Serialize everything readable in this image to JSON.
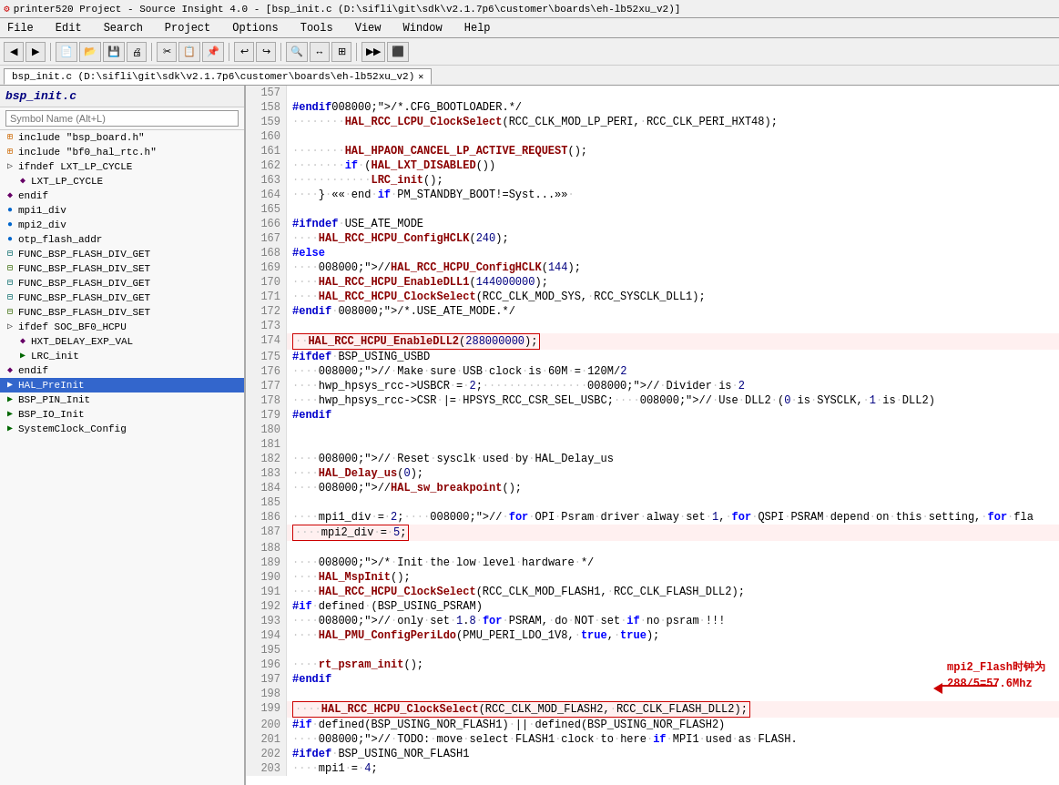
{
  "titlebar": {
    "logo": "⚙",
    "title": "printer520 Project - Source Insight 4.0 - [bsp_init.c (D:\\sifli\\git\\sdk\\v2.1.7p6\\customer\\boards\\eh-lb52xu_v2)]"
  },
  "menubar": {
    "items": [
      "File",
      "Edit",
      "Search",
      "Project",
      "Options",
      "Tools",
      "View",
      "Window",
      "Help"
    ]
  },
  "tab": {
    "label": "bsp_init.c (D:\\sifli\\git\\sdk\\v2.1.7p6\\customer\\boards\\eh-lb52xu_v2)",
    "close": "✕"
  },
  "leftpanel": {
    "title": "bsp_init.c",
    "search_placeholder": "Symbol Name (Alt+L)"
  },
  "tree": {
    "items": [
      {
        "indent": 0,
        "icon": "include",
        "label": "include \"bsp_board.h\""
      },
      {
        "indent": 0,
        "icon": "include",
        "label": "include \"bf0_hal_rtc.h\""
      },
      {
        "indent": 0,
        "icon": "expand",
        "label": "ifndef LXT_LP_CYCLE"
      },
      {
        "indent": 1,
        "icon": "define",
        "label": "LXT_LP_CYCLE"
      },
      {
        "indent": 0,
        "icon": "define",
        "label": "endif"
      },
      {
        "indent": 0,
        "icon": "var",
        "label": "mpi1_div"
      },
      {
        "indent": 0,
        "icon": "var",
        "label": "mpi2_div"
      },
      {
        "indent": 0,
        "icon": "var",
        "label": "otp_flash_addr"
      },
      {
        "indent": 0,
        "icon": "func_g",
        "label": "FUNC_BSP_FLASH_DIV_GET"
      },
      {
        "indent": 0,
        "icon": "func_s",
        "label": "FUNC_BSP_FLASH_DIV_SET"
      },
      {
        "indent": 0,
        "icon": "func_g",
        "label": "FUNC_BSP_FLASH_DIV_GET"
      },
      {
        "indent": 0,
        "icon": "func_g",
        "label": "FUNC_BSP_FLASH_DIV_GET"
      },
      {
        "indent": 0,
        "icon": "func_s",
        "label": "FUNC_BSP_FLASH_DIV_SET"
      },
      {
        "indent": 0,
        "icon": "expand",
        "label": "ifdef SOC_BF0_HCPU"
      },
      {
        "indent": 1,
        "icon": "define",
        "label": "HXT_DELAY_EXP_VAL"
      },
      {
        "indent": 1,
        "icon": "func",
        "label": "LRC_init"
      },
      {
        "indent": 0,
        "icon": "define",
        "label": "endif"
      },
      {
        "indent": 0,
        "icon": "func_sel",
        "label": "HAL_PreInit",
        "selected": true
      },
      {
        "indent": 0,
        "icon": "func",
        "label": "BSP_PIN_Init"
      },
      {
        "indent": 0,
        "icon": "func",
        "label": "BSP_IO_Init"
      },
      {
        "indent": 0,
        "icon": "func",
        "label": "SystemClock_Config"
      }
    ]
  },
  "code": {
    "lines": [
      {
        "num": 157,
        "content": ""
      },
      {
        "num": 158,
        "content": "#endif/*.CFG_BOOTLOADER.*/"
      },
      {
        "num": 159,
        "content": "········HAL_RCC_LCPU_ClockSelect(RCC_CLK_MOD_LP_PERI,·RCC_CLK_PERI_HXT48);"
      },
      {
        "num": 160,
        "content": ""
      },
      {
        "num": 161,
        "content": "········HAL_HPAON_CANCEL_LP_ACTIVE_REQUEST();"
      },
      {
        "num": 162,
        "content": "········if·(HAL_LXT_DISABLED())"
      },
      {
        "num": 163,
        "content": "············LRC_init();"
      },
      {
        "num": 164,
        "content": "····}·««·end·if·PM_STANDBY_BOOT!=Syst...»»·"
      },
      {
        "num": 165,
        "content": ""
      },
      {
        "num": 166,
        "content": "#ifndef·USE_ATE_MODE"
      },
      {
        "num": 167,
        "content": "····HAL_RCC_HCPU_ConfigHCLK(240);"
      },
      {
        "num": 168,
        "content": "#else"
      },
      {
        "num": 169,
        "content": "····//HAL_RCC_HCPU_ConfigHCLK(144);"
      },
      {
        "num": 170,
        "content": "····HAL_RCC_HCPU_EnableDLL1(144000000);"
      },
      {
        "num": 171,
        "content": "····HAL_RCC_HCPU_ClockSelect(RCC_CLK_MOD_SYS,·RCC_SYSCLK_DLL1);"
      },
      {
        "num": 172,
        "content": "#endif·/*.USE_ATE_MODE.*/"
      },
      {
        "num": 173,
        "content": ""
      },
      {
        "num": 174,
        "content": "··HAL_RCC_HCPU_EnableDLL2(288000000);",
        "highlight": true
      },
      {
        "num": 175,
        "content": "#ifdef·BSP_USING_USBD"
      },
      {
        "num": 176,
        "content": "····//·Make·sure·USB·clock·is·60M·=·120M/2"
      },
      {
        "num": 177,
        "content": "····hwp_hpsys_rcc->USBCR·=·2;················//·Divider·is·2"
      },
      {
        "num": 178,
        "content": "····hwp_hpsys_rcc->CSR·|=·HPSYS_RCC_CSR_SEL_USBC;····//·Use·DLL2·(0·is·SYSCLK,·1·is·DLL2)"
      },
      {
        "num": 179,
        "content": "#endif"
      },
      {
        "num": 180,
        "content": ""
      },
      {
        "num": 181,
        "content": ""
      },
      {
        "num": 182,
        "content": "····//·Reset·sysclk·used·by·HAL_Delay_us"
      },
      {
        "num": 183,
        "content": "····HAL_Delay_us(0);"
      },
      {
        "num": 184,
        "content": "····//HAL_sw_breakpoint();"
      },
      {
        "num": 185,
        "content": ""
      },
      {
        "num": 186,
        "content": "····mpi1_div·=·2;····//·for·OPI·Psram·driver·alway·set·1,·for·QSPI·PSRAM·depend·on·this·setting,·for·fla"
      },
      {
        "num": 187,
        "content": "····mpi2_div·=·5;",
        "highlight": true
      },
      {
        "num": 188,
        "content": ""
      },
      {
        "num": 189,
        "content": "····/*·Init·the·low·level·hardware·*/"
      },
      {
        "num": 190,
        "content": "····HAL_MspInit();"
      },
      {
        "num": 191,
        "content": "····HAL_RCC_HCPU_ClockSelect(RCC_CLK_MOD_FLASH1,·RCC_CLK_FLASH_DLL2);"
      },
      {
        "num": 192,
        "content": "#if·defined·(BSP_USING_PSRAM)"
      },
      {
        "num": 193,
        "content": "····//·only·set·1.8·for·PSRAM,·do·NOT·set·if·no·psram·!!!"
      },
      {
        "num": 194,
        "content": "····HAL_PMU_ConfigPeriLdo(PMU_PERI_LDO_1V8,·true,·true);"
      },
      {
        "num": 195,
        "content": ""
      },
      {
        "num": 196,
        "content": "····rt_psram_init();"
      },
      {
        "num": 197,
        "content": "#endif"
      },
      {
        "num": 198,
        "content": ""
      },
      {
        "num": 199,
        "content": "····HAL_RCC_HCPU_ClockSelect(RCC_CLK_MOD_FLASH2,·RCC_CLK_FLASH_DLL2);",
        "highlight": true
      },
      {
        "num": 200,
        "content": "#if·defined(BSP_USING_NOR_FLASH1)·||·defined(BSP_USING_NOR_FLASH2)"
      },
      {
        "num": 201,
        "content": "····//·TODO:·move·select·FLASH1·clock·to·here·if·MPI1·used·as·FLASH."
      },
      {
        "num": 202,
        "content": "#ifdef·BSP_USING_NOR_FLASH1"
      },
      {
        "num": 203,
        "content": "····mpi1·=·4;"
      }
    ]
  },
  "annotation": {
    "text": "mpi2_Flash时钟为\n288/5=57.6Mhz"
  }
}
